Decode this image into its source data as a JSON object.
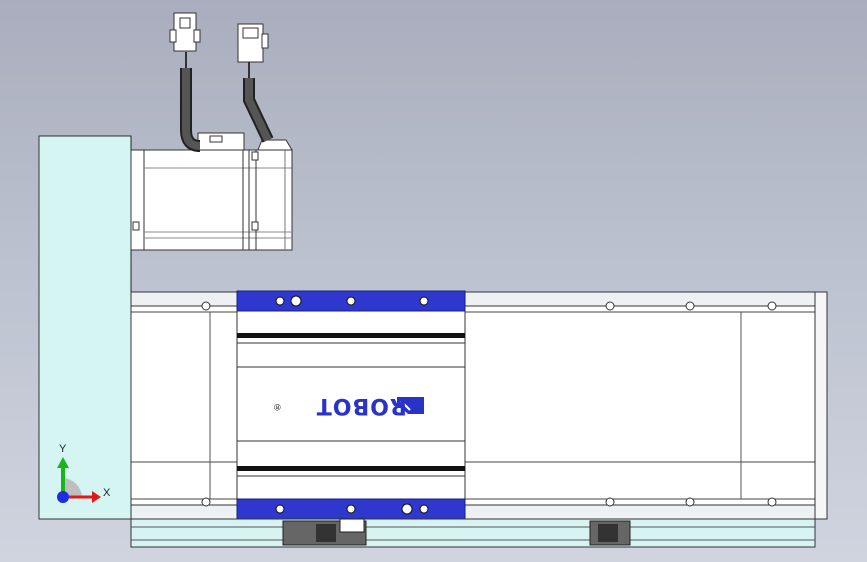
{
  "logo": {
    "text": "-ROBOT",
    "registered_mark": "®"
  },
  "triad": {
    "x_label": "X",
    "y_label": "Y"
  },
  "colors": {
    "background_top": "#a9adbd",
    "background_bottom": "#d0d4df",
    "mount_plate": "#d5f5f3",
    "carriage_plate": "#2e38cf",
    "logo_blue": "#2a33c8",
    "base_rail": "#d7f4f2"
  }
}
